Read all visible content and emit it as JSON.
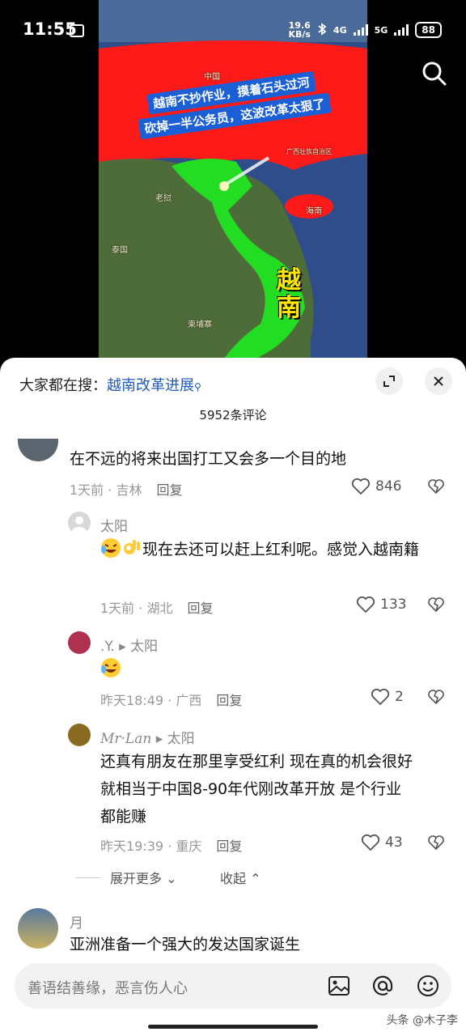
{
  "status_bar": {
    "time": "11:55",
    "net_speed_top": "19.6",
    "net_speed_unit": "KB/s",
    "network_a": "4G",
    "network_b": "5G",
    "battery": "88"
  },
  "video": {
    "caption_line1": "越南不抄作业，摸着石头过河",
    "caption_line2": "砍掉一半公务员，这波改革太狠了",
    "big_label": "越南",
    "map_labels": [
      "中国",
      "老挝",
      "泰国",
      "柬埔寨",
      "海南",
      "广西壮族自治区"
    ],
    "colors": {
      "red": "#ff1a1a",
      "green": "#22dd22",
      "sea": "#2f4d8a"
    }
  },
  "sheet": {
    "hot_search_prefix": "大家都在搜：",
    "hot_search_link": "越南改革进展",
    "comment_count": "5952条评论",
    "expand_label": "展开更多",
    "collapse_label": "收起"
  },
  "comments": [
    {
      "text": "在不远的将来出国打工又会多一个目的地",
      "time": "1天前",
      "location": "吉林",
      "reply": "回复",
      "likes": "846"
    },
    {
      "user": "太阳",
      "text": "现在去还可以赶上红利呢。感觉入越南籍",
      "time": "1天前",
      "location": "湖北",
      "reply": "回复",
      "likes": "133"
    },
    {
      "user": ".Y.",
      "reply_to": "太阳",
      "text": "",
      "time": "昨天18:49",
      "location": "广西",
      "reply": "回复",
      "likes": "2"
    },
    {
      "user": "Mr·Lan",
      "reply_to": "太阳",
      "text_line1": "还真有朋友在那里享受红利 现在真的机会很好",
      "text_line2": "就相当于中国8-90年代刚改革开放 是个行业",
      "text_line3": "都能赚",
      "time": "昨天19:39",
      "location": "重庆",
      "reply": "回复",
      "likes": "43"
    },
    {
      "user": "月",
      "text": "亚洲准备一个强大的发达国家诞生"
    }
  ],
  "input_bar": {
    "placeholder": "善语结善缘，恶言伤人心"
  },
  "watermark": "头条 @木子李"
}
